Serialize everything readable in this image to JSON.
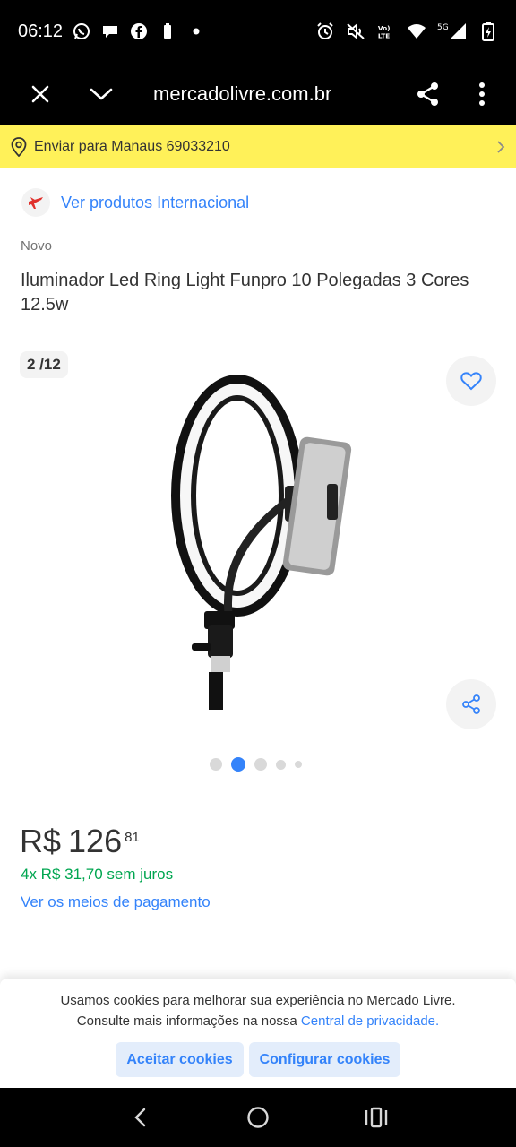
{
  "status_bar": {
    "time": "06:12",
    "left_icons": [
      "whatsapp-icon",
      "chat-bubble-icon",
      "facebook-icon",
      "battery-saver-icon",
      "dot-icon"
    ],
    "right_icons": [
      "alarm-icon",
      "mute-icon",
      "volte-icon",
      "wifi-icon",
      "signal-5g-icon",
      "battery-icon"
    ],
    "volte_label": "Vo) LTE",
    "network_label": "5G"
  },
  "browser": {
    "url": "mercadolivre.com.br"
  },
  "shipping": {
    "label": "Enviar para Manaus 69033210"
  },
  "product": {
    "international_link": "Ver produtos Internacional",
    "condition": "Novo",
    "title": "Iluminador Led Ring Light Funpro 10 Polegadas 3 Cores 12.5w",
    "gallery_counter": "2 /12",
    "gallery_dots": 5,
    "gallery_active_index": 1,
    "price_currency": "R$",
    "price_integer": "126",
    "price_cents": "81",
    "installments": "4x R$ 31,70 sem juros",
    "payment_link": "Ver os meios de pagamento"
  },
  "cookie_banner": {
    "line1": "Usamos cookies para melhorar sua experiência no Mercado Livre.",
    "line2_prefix": "Consulte mais informações na nossa ",
    "privacy_link": "Central de privacidade.",
    "accept_label": "Aceitar cookies",
    "configure_label": "Configurar cookies"
  },
  "colors": {
    "brand_yellow": "#fff159",
    "link_blue": "#3483fa",
    "price_green": "#00a650",
    "text": "#333333"
  }
}
